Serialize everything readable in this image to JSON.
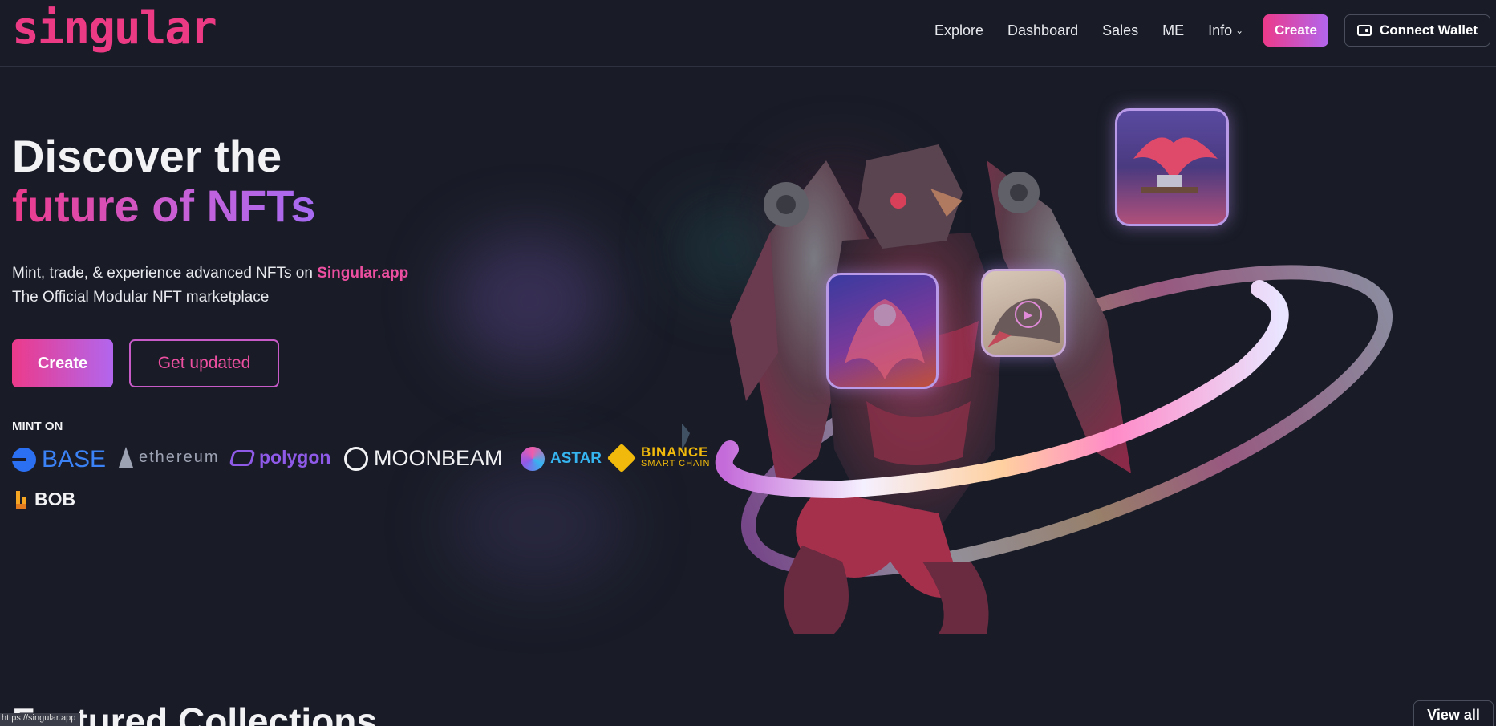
{
  "header": {
    "logo": "singular",
    "nav": [
      {
        "label": "Explore"
      },
      {
        "label": "Dashboard"
      },
      {
        "label": "Sales"
      },
      {
        "label": "ME"
      },
      {
        "label": "Info"
      }
    ],
    "create_label": "Create",
    "wallet_label": "Connect Wallet"
  },
  "hero": {
    "title_line1": "Discover the",
    "title_line2": "future of NFTs",
    "subtitle_prefix": "Mint, trade, & experience advanced NFTs on ",
    "subtitle_brand": "Singular.app",
    "subtitle_line2": "The Official Modular NFT marketplace",
    "create_label": "Create",
    "updated_label": "Get updated",
    "mint_on_label": "MINT ON"
  },
  "chains": {
    "base": "BASE",
    "ethereum": "ethereum",
    "polygon": "polygon",
    "moonbeam": "MOONBEAM",
    "astar": "ASTAR",
    "binance_line1": "BINANCE",
    "binance_line2": "SMART CHAIN",
    "bob": "BOB"
  },
  "featured": {
    "title": "Featured Collections",
    "view_all_label": "View all"
  },
  "status": {
    "url": "https://singular.app"
  },
  "colors": {
    "background": "#191c27",
    "accent_pink": "#ec3a8a",
    "accent_purple": "#b266ee"
  }
}
